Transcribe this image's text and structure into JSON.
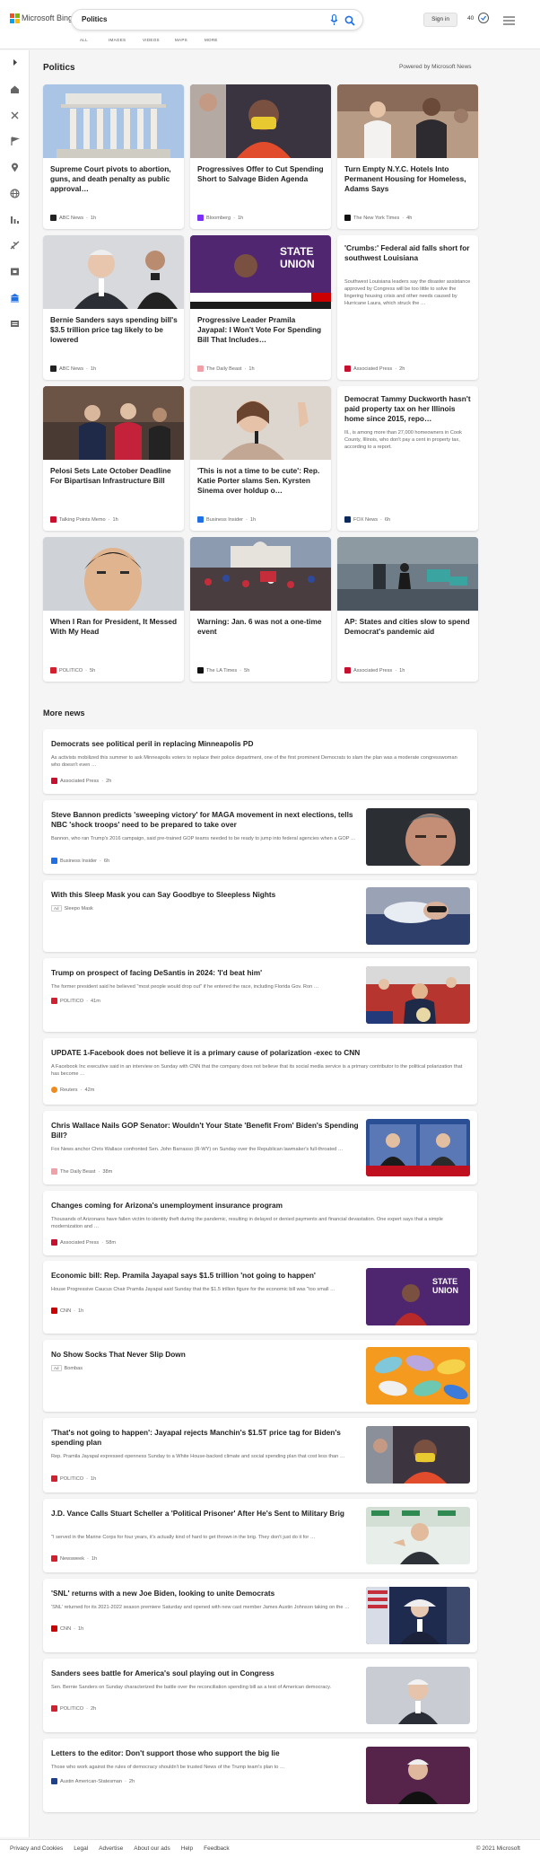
{
  "header": {
    "logo_text": "Microsoft Bing",
    "search_query": "Politics",
    "signin_label": "Sign in",
    "rewards_count": "40",
    "nav": [
      "ALL",
      "IMAGES",
      "VIDEOS",
      "MAPS",
      "MORE"
    ]
  },
  "section": {
    "title": "Politics",
    "powered": "Powered by Microsoft News"
  },
  "cards": [
    {
      "title": "Supreme Court pivots to abortion, guns, and death penalty as public approval…",
      "source": "ABC News",
      "time": "1h",
      "logo_color": "#222"
    },
    {
      "title": "Progressives Offer to Cut Spending Short to Salvage Biden Agenda",
      "source": "Bloomberg",
      "time": "1h",
      "logo_color": "#7b2ff7"
    },
    {
      "title": "Turn Empty N.Y.C. Hotels Into Permanent Housing for Homeless, Adams Says",
      "source": "The New York Times",
      "time": "4h",
      "logo_color": "#111"
    },
    {
      "title": "Bernie Sanders says spending bill's $3.5 trillion price tag likely to be lowered",
      "source": "ABC News",
      "time": "1h",
      "logo_color": "#222"
    },
    {
      "title": "Progressive Leader Pramila Jayapal: I Won't Vote For Spending Bill That Includes…",
      "source": "The Daily Beast",
      "time": "1h",
      "logo_color": "#f2a0a8"
    },
    {
      "title": "'Crumbs:' Federal aid falls short for southwest Louisiana",
      "snippet": "Southwest Louisiana leaders say the disaster assistance approved by Congress will be too little to solve the lingering housing crisis and other needs caused by Hurricane Laura, which struck the …",
      "source": "Associated Press",
      "time": "2h",
      "logo_color": "#c8102e"
    },
    {
      "title": "Pelosi Sets Late October Deadline For Bipartisan Infrastructure Bill",
      "source": "Talking Points Memo",
      "time": "1h",
      "logo_color": "#c8102e"
    },
    {
      "title": "'This is not a time to be cute': Rep. Katie Porter slams Sen. Kyrsten Sinema over holdup o…",
      "source": "Business Insider",
      "time": "1h",
      "logo_color": "#1f6fe5"
    },
    {
      "title": "Democrat Tammy Duckworth hasn't paid property tax on her Illinois home since 2015, repo…",
      "snippet": "Ill., is among more than 27,000 homeowners in Cook County, Illinois, who don't pay a cent in property tax, according to a report.",
      "source": "FOX News",
      "time": "6h",
      "logo_color": "#0b2a5b"
    },
    {
      "title": "When I Ran for President, It Messed With My Head",
      "source": "POLITICO",
      "time": "5h",
      "logo_color": "#d2202f"
    },
    {
      "title": "Warning: Jan. 6 was not a one-time event",
      "source": "The LA Times",
      "time": "5h",
      "logo_color": "#111"
    },
    {
      "title": "AP: States and cities slow to spend Democrat's pandemic aid",
      "source": "Associated Press",
      "time": "1h",
      "logo_color": "#c8102e"
    }
  ],
  "more_news_title": "More news",
  "more": [
    {
      "title": "Democrats see political peril in replacing Minneapolis PD",
      "snippet": "As activists mobilized this summer to ask Minneapolis voters to replace their police department, one of the first prominent Democrats to slam the plan was a moderate congresswoman who doesn't even …",
      "source": "Associated Press",
      "time": "2h",
      "logo_color": "#c8102e"
    },
    {
      "title": "Steve Bannon predicts 'sweeping victory' for MAGA movement in next elections, tells NBC 'shock troops' need to be prepared to take over",
      "snippet": "Bannon, who ran Trump's 2016 campaign, said pre-trained GOP teams needed to be ready to jump into federal agencies when a GOP …",
      "source": "Business Insider",
      "time": "6h",
      "logo_color": "#1f6fe5"
    },
    {
      "title": "With this Sleep Mask you can Say Goodbye to Sleepless Nights",
      "ad": "Ad",
      "source": "Sleepo Mask",
      "logo_color": ""
    },
    {
      "title": "Trump on prospect of facing DeSantis in 2024: 'I'd beat him'",
      "snippet": "The former president said he believed \"most people would drop out\" if he entered the race, including Florida Gov. Ron …",
      "source": "POLITICO",
      "time": "41m",
      "logo_color": "#d2202f"
    },
    {
      "title": "UPDATE 1-Facebook does not believe it is a primary cause of polarization -exec to CNN",
      "snippet": "A Facebook Inc executive said in an interview on Sunday with CNN that the company does not believe that its social media service is a primary contributor to the political polarization that has become …",
      "source": "Reuters",
      "time": "42m",
      "logo_color": "#f08a1c"
    },
    {
      "title": "Chris Wallace Nails GOP Senator: Wouldn't Your State 'Benefit From' Biden's Spending Bill?",
      "snippet": "Fox News anchor Chris Wallace confronted Sen. John Barrasso (R-WY) on Sunday over the Republican lawmaker's full-throated …",
      "source": "The Daily Beast",
      "time": "38m",
      "logo_color": "#f2a0a8"
    },
    {
      "title": "Changes coming for Arizona's unemployment insurance program",
      "snippet": "Thousands of Arizonans have fallen victim to identity theft during the pandemic, resulting in delayed or denied payments and financial devastation. One expert says that a simple modernization and …",
      "source": "Associated Press",
      "time": "58m",
      "logo_color": "#c8102e"
    },
    {
      "title": "Economic bill: Rep. Pramila Jayapal says $1.5 trillion 'not going to happen'",
      "snippet": "House Progressive Caucus Chair Pramila Jayapal said Sunday that the $1.5 trillion figure for the economic bill was \"too small …",
      "source": "CNN",
      "time": "1h",
      "logo_color": "#cc0000"
    },
    {
      "title": "No Show Socks That Never Slip Down",
      "ad": "Ad",
      "source": "Bombas",
      "logo_color": ""
    },
    {
      "title": "'That's not going to happen': Jayapal rejects Manchin's $1.5T price tag for Biden's spending plan",
      "snippet": "Rep. Pramila Jayapal expressed openness Sunday to a White House-backed climate and social spending plan that cost less than …",
      "source": "POLITICO",
      "time": "1h",
      "logo_color": "#d2202f"
    },
    {
      "title": "J.D. Vance Calls Stuart Scheller a 'Political Prisoner' After He's Sent to Military Brig",
      "snippet": "\"I served in the Marine Corps for four years, it's actually kind of hard to get thrown in the brig. They don't just do it for …",
      "source": "Newsweek",
      "time": "1h",
      "logo_color": "#d2202f"
    },
    {
      "title": "'SNL' returns with a new Joe Biden, looking to unite Democrats",
      "snippet": "'SNL' returned for its 2021-2022 season premiere Saturday and opened with new cast member James Austin Johnson taking on the …",
      "source": "CNN",
      "time": "1h",
      "logo_color": "#cc0000"
    },
    {
      "title": "Sanders sees battle for America's soul playing out in Congress",
      "snippet": "Sen. Bernie Sanders on Sunday characterized the battle over the reconciliation spending bill as a test of American democracy.",
      "source": "POLITICO",
      "time": "2h",
      "logo_color": "#d2202f"
    },
    {
      "title": "Letters to the editor: Don't support those who support the big lie",
      "snippet": "Those who work against the rules of democracy shouldn't be trusted News of the Trump team's plan to …",
      "source": "Austin American-Statesman",
      "time": "2h",
      "logo_color": "#1d3f8f"
    }
  ],
  "footer": {
    "links": [
      "Privacy and Cookies",
      "Legal",
      "Advertise",
      "About our ads",
      "Help",
      "Feedback"
    ],
    "copyright": "© 2021 Microsoft"
  },
  "icons": [
    "mic-icon",
    "search-icon",
    "rewards-icon",
    "menu-icon",
    "expand-icon",
    "home-icon",
    "sports-icon",
    "flag-icon",
    "map-pin-icon",
    "globe-icon",
    "chart-icon",
    "plane-icon",
    "entertainment-icon",
    "politics-icon",
    "news-icon"
  ]
}
